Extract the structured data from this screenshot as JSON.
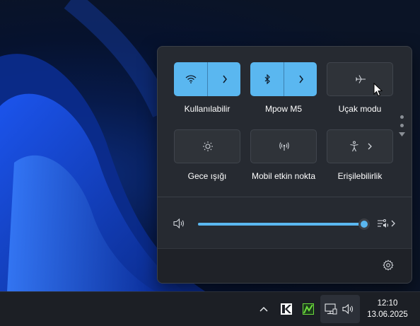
{
  "quick_settings": {
    "tiles": [
      {
        "label": "Kullanılabilir",
        "icon": "wifi-icon",
        "state": "on",
        "split": true
      },
      {
        "label": "Mpow M5",
        "icon": "bluetooth-icon",
        "state": "on",
        "split": true
      },
      {
        "label": "Uçak modu",
        "icon": "airplane-icon",
        "state": "off",
        "split": false
      },
      {
        "label": "Gece ışığı",
        "icon": "night-light-icon",
        "state": "off",
        "split": false
      },
      {
        "label": "Mobil etkin nokta",
        "icon": "hotspot-icon",
        "state": "off",
        "split": false
      },
      {
        "label": "Erişilebilirlik",
        "icon": "accessibility-icon",
        "state": "off",
        "split": false
      }
    ],
    "volume": {
      "level": 100,
      "icon": "speaker-icon"
    },
    "audio_output_icon": "audio-output-icon",
    "settings_icon": "gear-icon"
  },
  "taskbar": {
    "tray_icons": [
      "chevron-up-icon",
      "app-k-icon",
      "app-green-icon",
      "network-icon",
      "volume-icon"
    ],
    "time": "12:10",
    "date": "13.06.2025"
  },
  "colors": {
    "accent": "#5ab7f0",
    "panel_bg": "#262a31",
    "tile_off": "#2f3339",
    "taskbar_bg": "#1c1f25"
  }
}
